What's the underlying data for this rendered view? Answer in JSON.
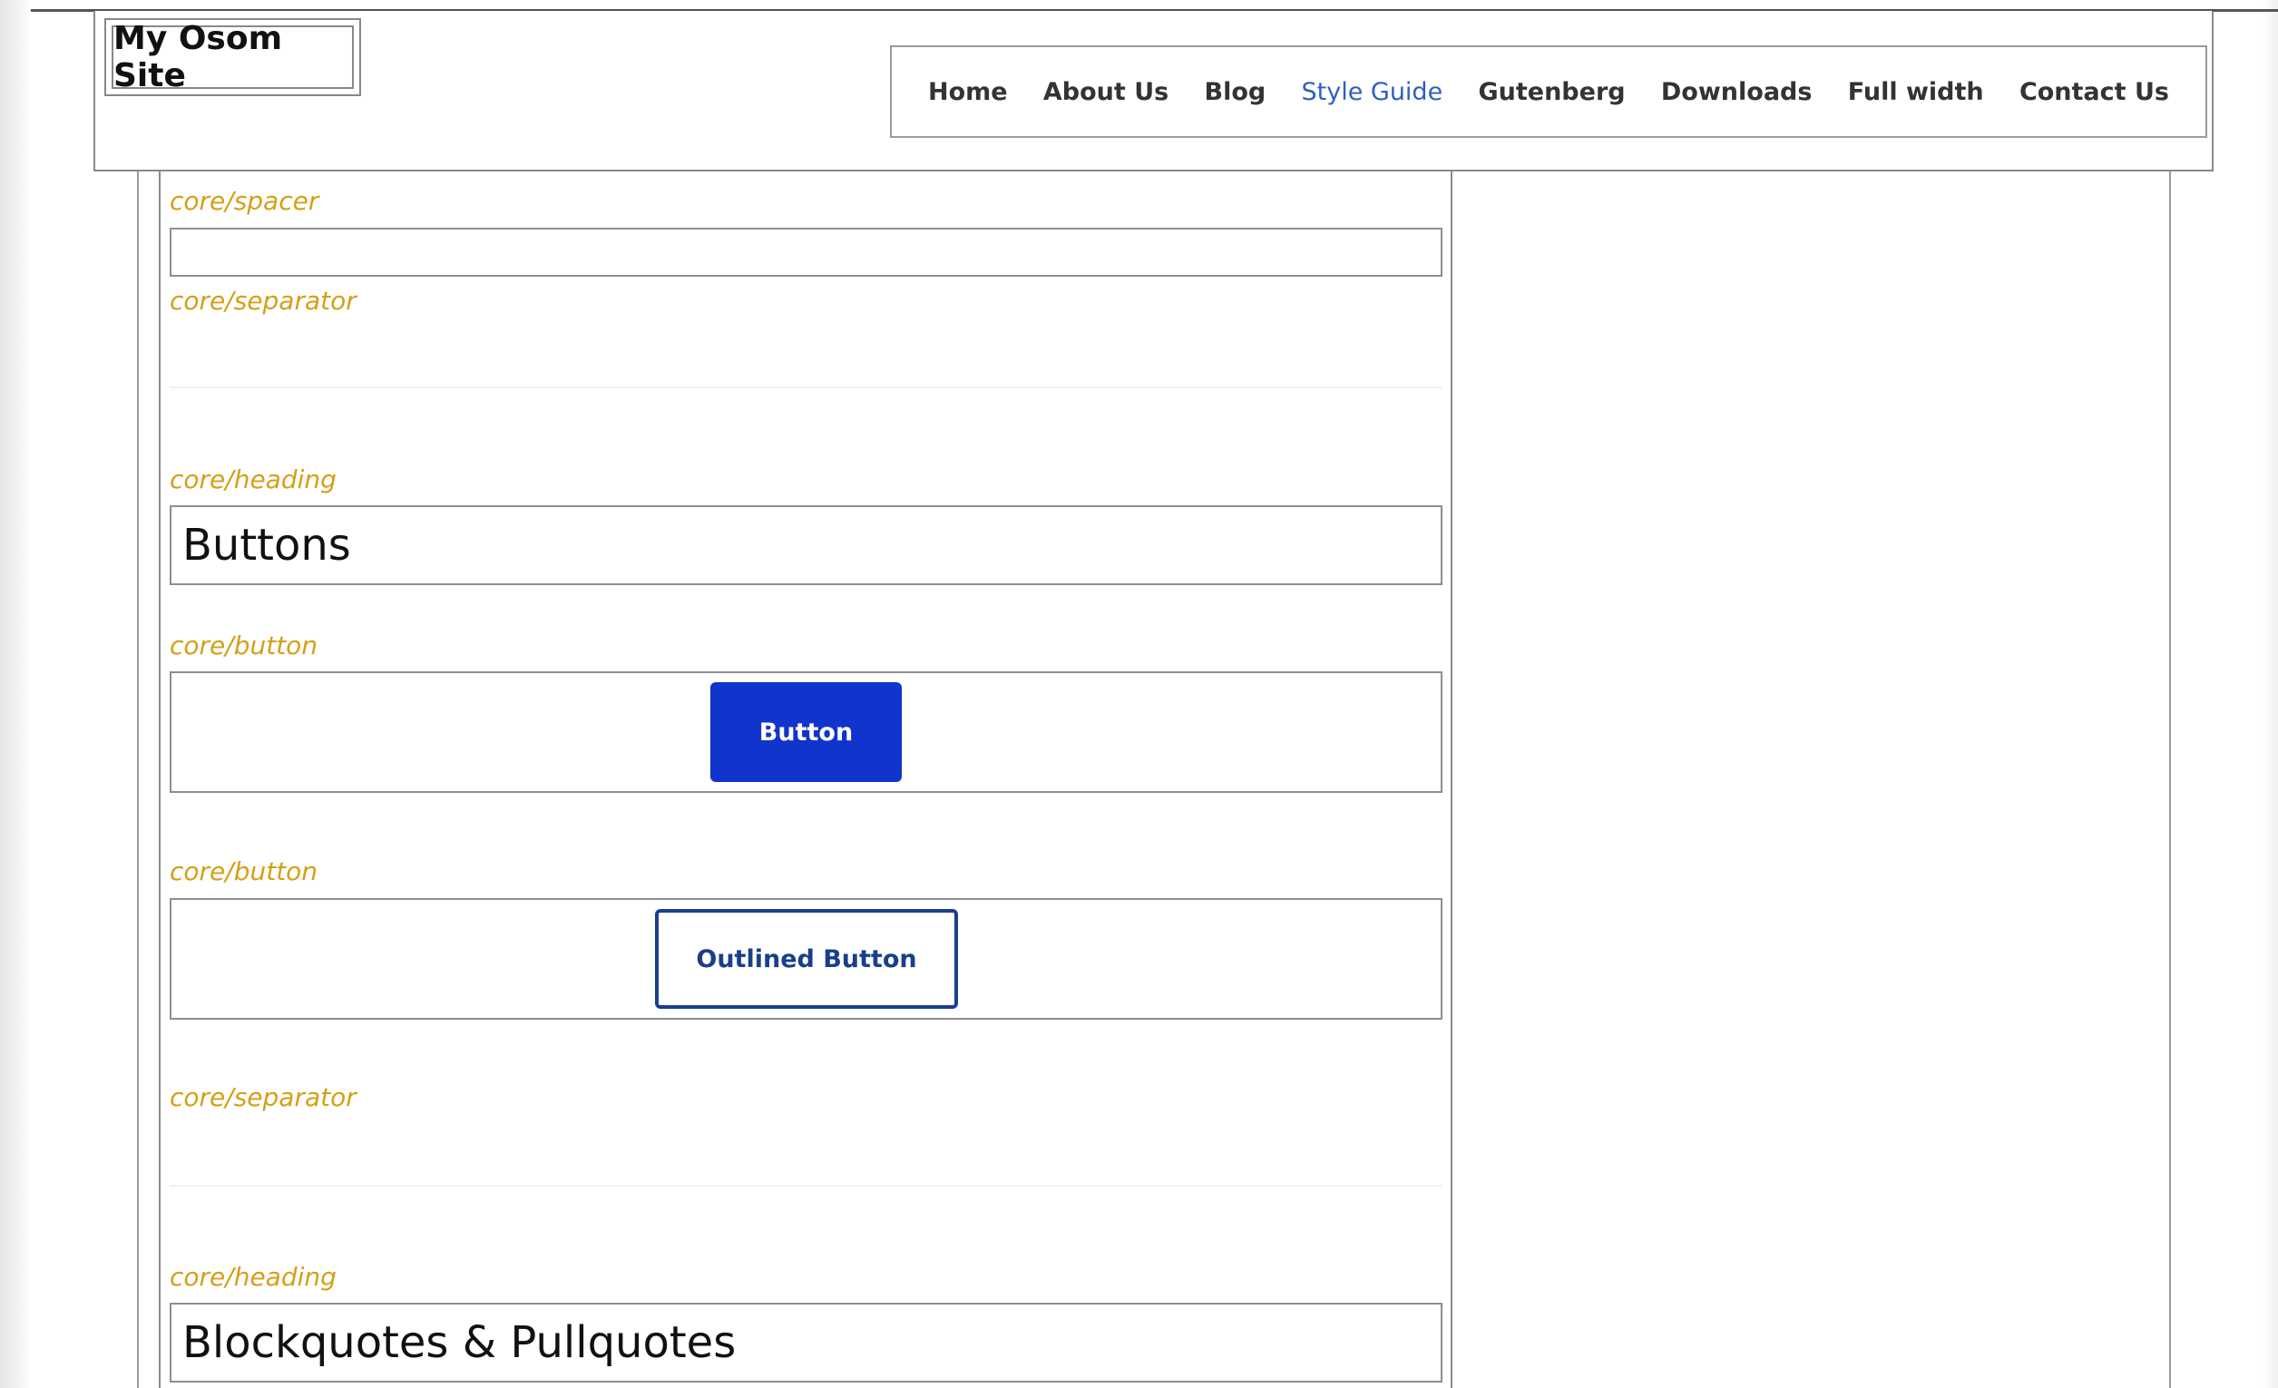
{
  "site": {
    "title": "My Osom Site"
  },
  "nav": {
    "items": [
      {
        "label": "Home"
      },
      {
        "label": "About Us"
      },
      {
        "label": "Blog"
      },
      {
        "label": "Style Guide",
        "active": true
      },
      {
        "label": "Gutenberg"
      },
      {
        "label": "Downloads"
      },
      {
        "label": "Full width"
      },
      {
        "label": "Contact Us"
      }
    ]
  },
  "blocks": {
    "spacer_tag": "core/spacer",
    "separator_tag_1": "core/separator",
    "heading_tag_1": "core/heading",
    "heading_1": "Buttons",
    "button_tag_1": "core/button",
    "button_1_label": "Button",
    "button_tag_2": "core/button",
    "button_2_label": "Outlined Button",
    "separator_tag_2": "core/separator",
    "heading_tag_2": "core/heading",
    "heading_2": "Blockquotes & Pullquotes"
  },
  "colors": {
    "block_tag": "#d4a017",
    "nav_active": "#2f5fbf",
    "button_fill": "#1034cc",
    "button_outline": "#1a3f8a"
  }
}
